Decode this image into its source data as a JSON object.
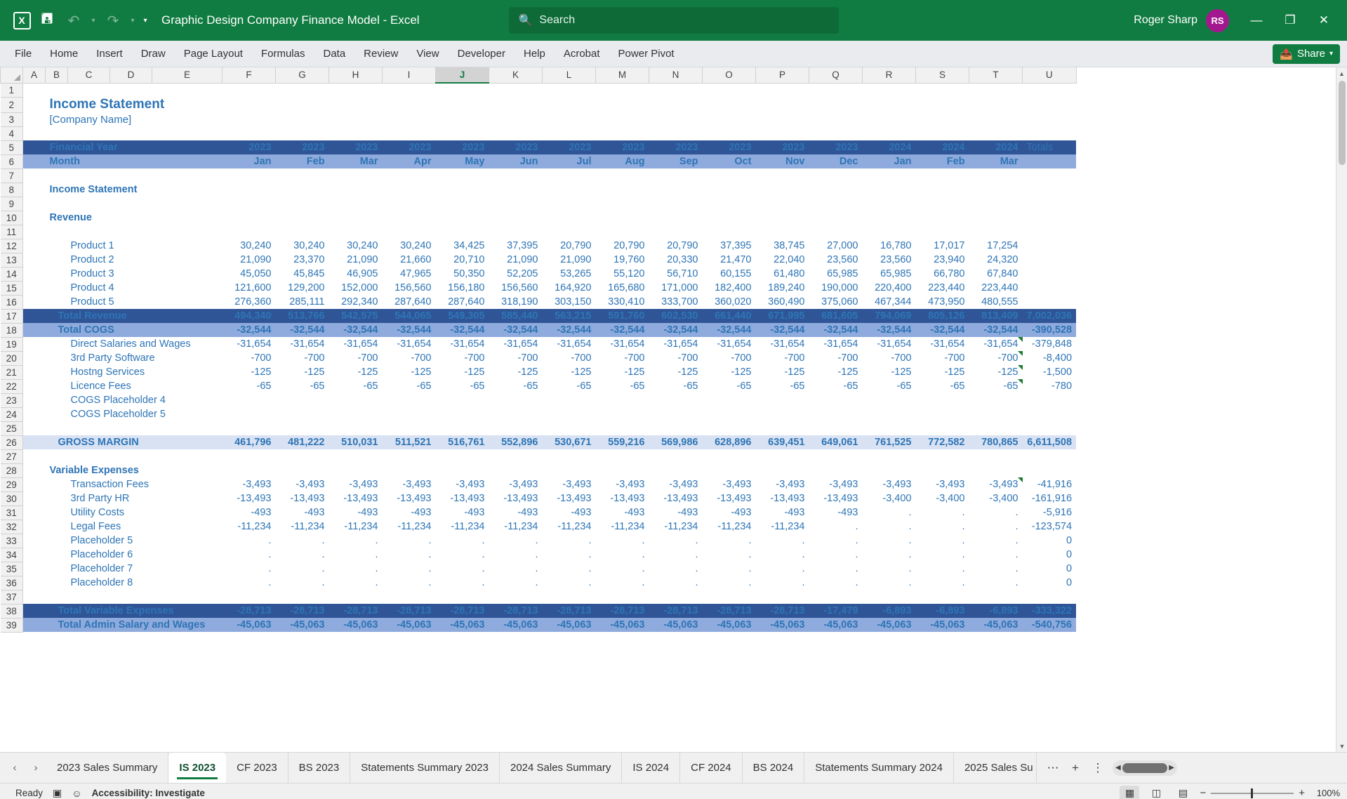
{
  "titlebar": {
    "app_icon": "excel-logo-icon",
    "save_icon": "save-icon",
    "undo_icon": "undo-icon",
    "redo_icon": "redo-icon",
    "qat_more_icon": "qat-overflow-icon",
    "document_title": "Graphic Design Company Finance Model  -  Excel",
    "search_icon": "search-icon",
    "search_placeholder": "Search",
    "search_value": "",
    "user_name": "Roger Sharp",
    "user_initials": "RS",
    "avatar_color": "#a4188f",
    "minimize_icon": "minimize-icon",
    "restore_icon": "restore-icon",
    "close_icon": "close-icon",
    "brand_color": "#107c41"
  },
  "ribbon": {
    "tabs": [
      "File",
      "Home",
      "Insert",
      "Draw",
      "Page Layout",
      "Formulas",
      "Data",
      "Review",
      "View",
      "Developer",
      "Help",
      "Acrobat",
      "Power Pivot"
    ],
    "share_label": "Share",
    "share_icon": "share-icon",
    "share_caret_icon": "chevron-down-icon"
  },
  "grid": {
    "columns": [
      "A",
      "B",
      "C",
      "D",
      "E",
      "F",
      "G",
      "H",
      "I",
      "J",
      "K",
      "L",
      "M",
      "N",
      "O",
      "P",
      "Q",
      "R",
      "S",
      "T",
      "U"
    ],
    "selected_column": "J",
    "row_numbers": [
      1,
      2,
      3,
      4,
      5,
      6,
      7,
      8,
      9,
      10,
      11,
      12,
      13,
      14,
      15,
      16,
      17,
      18,
      19,
      20,
      21,
      22,
      23,
      24,
      25,
      26,
      27,
      28,
      29,
      30,
      31,
      32,
      33,
      34,
      35,
      36,
      37,
      38,
      39
    ],
    "select_all_icon": "select-all-corner-icon",
    "vscroll_up_icon": "scroll-up-icon",
    "vscroll_down_icon": "scroll-down-icon"
  },
  "sheet": {
    "title": "Income Statement",
    "company": "[Company Name]",
    "section_income_statement": "Income Statement",
    "section_revenue": "Revenue",
    "section_variable_expenses": "Variable Expenses",
    "header_financial_year_label": "Financial Year",
    "header_month_label": "Month",
    "header_totals_label": "Totals",
    "years": [
      "2023",
      "2023",
      "2023",
      "2023",
      "2023",
      "2023",
      "2023",
      "2023",
      "2023",
      "2023",
      "2023",
      "2023",
      "2024",
      "2024",
      "2024"
    ],
    "months": [
      "Jan",
      "Feb",
      "Mar",
      "Apr",
      "May",
      "Jun",
      "Jul",
      "Aug",
      "Sep",
      "Oct",
      "Nov",
      "Dec",
      "Jan",
      "Feb",
      "Mar"
    ],
    "rows": [
      {
        "row": 12,
        "label": "Product 1",
        "style": "item",
        "values": [
          "30,240",
          "30,240",
          "30,240",
          "30,240",
          "34,425",
          "37,395",
          "20,790",
          "20,790",
          "20,790",
          "37,395",
          "38,745",
          "27,000",
          "16,780",
          "17,017",
          "17,254"
        ],
        "total": ""
      },
      {
        "row": 13,
        "label": "Product 2",
        "style": "item",
        "values": [
          "21,090",
          "23,370",
          "21,090",
          "21,660",
          "20,710",
          "21,090",
          "21,090",
          "19,760",
          "20,330",
          "21,470",
          "22,040",
          "23,560",
          "23,560",
          "23,940",
          "24,320"
        ],
        "total": ""
      },
      {
        "row": 14,
        "label": "Product 3",
        "style": "item",
        "values": [
          "45,050",
          "45,845",
          "46,905",
          "47,965",
          "50,350",
          "52,205",
          "53,265",
          "55,120",
          "56,710",
          "60,155",
          "61,480",
          "65,985",
          "65,985",
          "66,780",
          "67,840"
        ],
        "total": ""
      },
      {
        "row": 15,
        "label": "Product 4",
        "style": "item",
        "values": [
          "121,600",
          "129,200",
          "152,000",
          "156,560",
          "156,180",
          "156,560",
          "164,920",
          "165,680",
          "171,000",
          "182,400",
          "189,240",
          "190,000",
          "220,400",
          "223,440",
          "223,440"
        ],
        "total": ""
      },
      {
        "row": 16,
        "label": "Product 5",
        "style": "item",
        "values": [
          "276,360",
          "285,111",
          "292,340",
          "287,640",
          "287,640",
          "318,190",
          "303,150",
          "330,410",
          "333,700",
          "360,020",
          "360,490",
          "375,060",
          "467,344",
          "473,950",
          "480,555"
        ],
        "total": ""
      },
      {
        "row": 17,
        "label": "Total Revenue",
        "style": "dark",
        "values": [
          "494,340",
          "513,766",
          "542,575",
          "544,065",
          "549,305",
          "585,440",
          "563,215",
          "591,760",
          "602,530",
          "661,440",
          "671,995",
          "681,605",
          "794,069",
          "805,126",
          "813,409"
        ],
        "total": "7,002,036"
      },
      {
        "row": 18,
        "label": "Total COGS",
        "style": "mid",
        "values": [
          "-32,544",
          "-32,544",
          "-32,544",
          "-32,544",
          "-32,544",
          "-32,544",
          "-32,544",
          "-32,544",
          "-32,544",
          "-32,544",
          "-32,544",
          "-32,544",
          "-32,544",
          "-32,544",
          "-32,544"
        ],
        "total": "-390,528"
      },
      {
        "row": 19,
        "label": "Direct Salaries and Wages",
        "style": "item",
        "values": [
          "-31,654",
          "-31,654",
          "-31,654",
          "-31,654",
          "-31,654",
          "-31,654",
          "-31,654",
          "-31,654",
          "-31,654",
          "-31,654",
          "-31,654",
          "-31,654",
          "-31,654",
          "-31,654",
          "-31,654"
        ],
        "total": "-379,848",
        "error_flag": true
      },
      {
        "row": 20,
        "label": "3rd Party Software",
        "style": "item",
        "values": [
          "-700",
          "-700",
          "-700",
          "-700",
          "-700",
          "-700",
          "-700",
          "-700",
          "-700",
          "-700",
          "-700",
          "-700",
          "-700",
          "-700",
          "-700"
        ],
        "total": "-8,400",
        "error_flag": true
      },
      {
        "row": 21,
        "label": "Hostng Services",
        "style": "item",
        "values": [
          "-125",
          "-125",
          "-125",
          "-125",
          "-125",
          "-125",
          "-125",
          "-125",
          "-125",
          "-125",
          "-125",
          "-125",
          "-125",
          "-125",
          "-125"
        ],
        "total": "-1,500",
        "error_flag": true
      },
      {
        "row": 22,
        "label": "Licence Fees",
        "style": "item",
        "values": [
          "-65",
          "-65",
          "-65",
          "-65",
          "-65",
          "-65",
          "-65",
          "-65",
          "-65",
          "-65",
          "-65",
          "-65",
          "-65",
          "-65",
          "-65"
        ],
        "total": "-780",
        "error_flag": true
      },
      {
        "row": 23,
        "label": "COGS Placeholder 4",
        "style": "item",
        "values": [
          "",
          "",
          "",
          "",
          "",
          "",
          "",
          "",
          "",
          "",
          "",
          "",
          "",
          "",
          ""
        ],
        "total": ""
      },
      {
        "row": 24,
        "label": "COGS Placeholder 5",
        "style": "item",
        "values": [
          "",
          "",
          "",
          "",
          "",
          "",
          "",
          "",
          "",
          "",
          "",
          "",
          "",
          "",
          ""
        ],
        "total": ""
      },
      {
        "row": 25,
        "label": "",
        "style": "blank",
        "values": [
          "",
          "",
          "",
          "",
          "",
          "",
          "",
          "",
          "",
          "",
          "",
          "",
          "",
          "",
          ""
        ],
        "total": ""
      },
      {
        "row": 26,
        "label": "GROSS MARGIN",
        "style": "light",
        "values": [
          "461,796",
          "481,222",
          "510,031",
          "511,521",
          "516,761",
          "552,896",
          "530,671",
          "559,216",
          "569,986",
          "628,896",
          "639,451",
          "649,061",
          "761,525",
          "772,582",
          "780,865"
        ],
        "total": "6,611,508"
      },
      {
        "row": 27,
        "label": "",
        "style": "blank",
        "values": [
          "",
          "",
          "",
          "",
          "",
          "",
          "",
          "",
          "",
          "",
          "",
          "",
          "",
          "",
          ""
        ],
        "total": ""
      },
      {
        "row": 29,
        "label": "Transaction Fees",
        "style": "item",
        "values": [
          "-3,493",
          "-3,493",
          "-3,493",
          "-3,493",
          "-3,493",
          "-3,493",
          "-3,493",
          "-3,493",
          "-3,493",
          "-3,493",
          "-3,493",
          "-3,493",
          "-3,493",
          "-3,493",
          "-3,493"
        ],
        "total": "-41,916",
        "error_flag": true
      },
      {
        "row": 30,
        "label": "3rd Party HR",
        "style": "item",
        "values": [
          "-13,493",
          "-13,493",
          "-13,493",
          "-13,493",
          "-13,493",
          "-13,493",
          "-13,493",
          "-13,493",
          "-13,493",
          "-13,493",
          "-13,493",
          "-13,493",
          "-3,400",
          "-3,400",
          "-3,400"
        ],
        "total": "-161,916"
      },
      {
        "row": 31,
        "label": "Utility Costs",
        "style": "item",
        "values": [
          "-493",
          "-493",
          "-493",
          "-493",
          "-493",
          "-493",
          "-493",
          "-493",
          "-493",
          "-493",
          "-493",
          "-493",
          ".",
          ".",
          "."
        ],
        "total": "-5,916"
      },
      {
        "row": 32,
        "label": "Legal Fees",
        "style": "item",
        "values": [
          "-11,234",
          "-11,234",
          "-11,234",
          "-11,234",
          "-11,234",
          "-11,234",
          "-11,234",
          "-11,234",
          "-11,234",
          "-11,234",
          "-11,234",
          ".",
          ".",
          ".",
          "."
        ],
        "total": "-123,574"
      },
      {
        "row": 33,
        "label": "Placeholder 5",
        "style": "item",
        "values": [
          ".",
          ".",
          ".",
          ".",
          ".",
          ".",
          ".",
          ".",
          ".",
          ".",
          ".",
          ".",
          ".",
          ".",
          "."
        ],
        "total": "0"
      },
      {
        "row": 34,
        "label": "Placeholder 6",
        "style": "item",
        "values": [
          ".",
          ".",
          ".",
          ".",
          ".",
          ".",
          ".",
          ".",
          ".",
          ".",
          ".",
          ".",
          ".",
          ".",
          "."
        ],
        "total": "0"
      },
      {
        "row": 35,
        "label": "Placeholder 7",
        "style": "item",
        "values": [
          ".",
          ".",
          ".",
          ".",
          ".",
          ".",
          ".",
          ".",
          ".",
          ".",
          ".",
          ".",
          ".",
          ".",
          "."
        ],
        "total": "0"
      },
      {
        "row": 36,
        "label": "Placeholder 8",
        "style": "item",
        "values": [
          ".",
          ".",
          ".",
          ".",
          ".",
          ".",
          ".",
          ".",
          ".",
          ".",
          ".",
          ".",
          ".",
          ".",
          "."
        ],
        "total": "0"
      },
      {
        "row": 37,
        "label": "",
        "style": "blank",
        "values": [
          "",
          "",
          "",
          "",
          "",
          "",
          "",
          "",
          "",
          "",
          "",
          "",
          "",
          "",
          ""
        ],
        "total": ""
      },
      {
        "row": 38,
        "label": "Total Variable Expenses",
        "style": "dark",
        "values": [
          "-28,713",
          "-28,713",
          "-28,713",
          "-28,713",
          "-28,713",
          "-28,713",
          "-28,713",
          "-28,713",
          "-28,713",
          "-28,713",
          "-28,713",
          "-17,479",
          "-6,893",
          "-6,893",
          "-6,893"
        ],
        "total": "-333,322"
      },
      {
        "row": 39,
        "label": "Total Admin Salary and Wages",
        "style": "mid",
        "values": [
          "-45,063",
          "-45,063",
          "-45,063",
          "-45,063",
          "-45,063",
          "-45,063",
          "-45,063",
          "-45,063",
          "-45,063",
          "-45,063",
          "-45,063",
          "-45,063",
          "-45,063",
          "-45,063",
          "-45,063"
        ],
        "total": "-540,756"
      }
    ]
  },
  "tabbar": {
    "prev_icon": "prev-sheet-icon",
    "next_icon": "next-sheet-icon",
    "tabs": [
      {
        "label": "2023 Sales Summary",
        "active": false
      },
      {
        "label": "IS 2023",
        "active": true
      },
      {
        "label": "CF 2023",
        "active": false
      },
      {
        "label": "BS 2023",
        "active": false
      },
      {
        "label": "Statements Summary 2023",
        "active": false
      },
      {
        "label": "2024 Sales Summary",
        "active": false
      },
      {
        "label": "IS 2024",
        "active": false
      },
      {
        "label": "CF 2024",
        "active": false
      },
      {
        "label": "BS 2024",
        "active": false
      },
      {
        "label": "Statements Summary 2024",
        "active": false
      },
      {
        "label": "2025 Sales Su",
        "active": false
      }
    ],
    "more_icon": "more-sheets-icon",
    "add_sheet_icon": "add-sheet-icon",
    "sheet_menu_icon": "sheet-options-icon"
  },
  "status": {
    "mode": "Ready",
    "macro_icon": "record-macro-icon",
    "accessibility_icon": "accessibility-icon",
    "accessibility_label": "Accessibility: Investigate",
    "view_normal_icon": "normal-view-icon",
    "view_pagelayout_icon": "page-layout-view-icon",
    "view_pagebreak_icon": "page-break-view-icon",
    "zoom_out_icon": "zoom-out-icon",
    "zoom_in_icon": "zoom-in-icon",
    "zoom_level": "100%"
  }
}
